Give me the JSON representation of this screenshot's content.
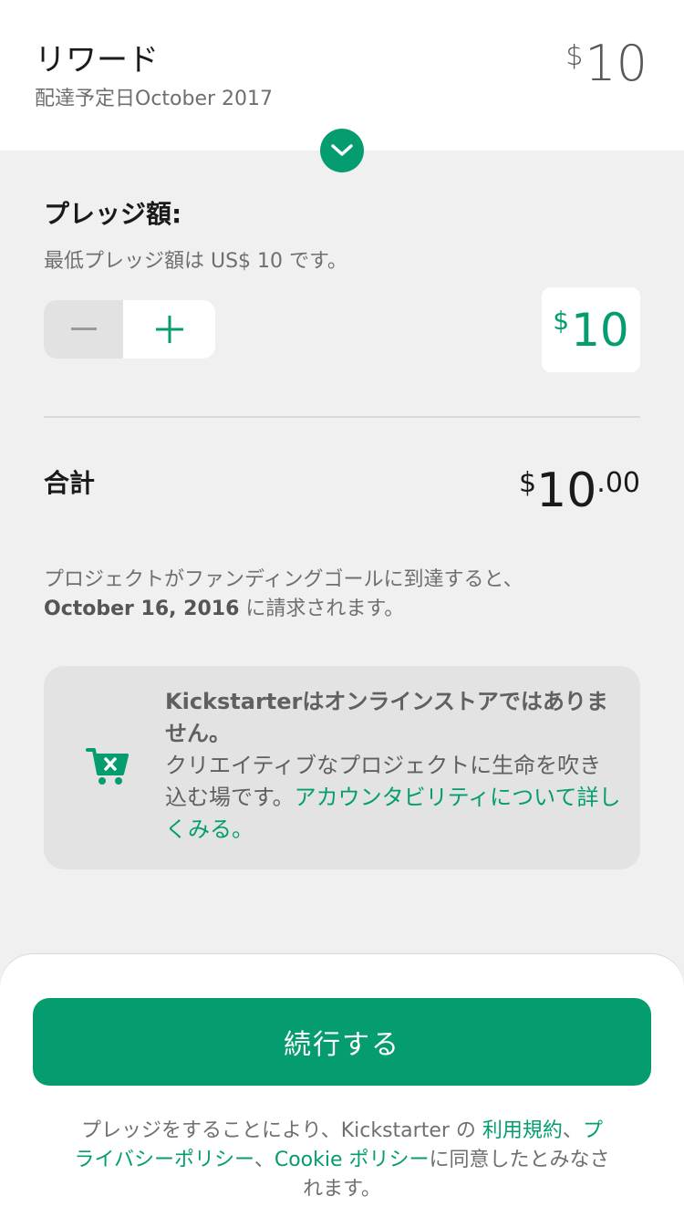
{
  "header": {
    "title": "リワード",
    "subtitle": "配達予定日October 2017",
    "price_currency": "$",
    "price_value": "10"
  },
  "pledge": {
    "label": "プレッジ額:",
    "minimum_note": "最低プレッジ額は US$ 10 です。",
    "amount_currency": "$",
    "amount_value": "10"
  },
  "total": {
    "label": "合計",
    "currency": "$",
    "whole": "10",
    "cents": ".00"
  },
  "charge_note": {
    "line1": "プロジェクトがファンディングゴールに到達すると、",
    "date": "October 16, 2016",
    "line2_suffix": " に請求されます。"
  },
  "info_card": {
    "bold_text": "Kickstarterはオンラインストアではありません。",
    "body_text": "クリエイティブなプロジェクトに生命を吹き込む場です。",
    "link_text": "アカウンタビリティについて詳しくみる。"
  },
  "footer": {
    "continue_label": "続行する",
    "legal_prefix": "プレッジをすることにより、Kickstarter の ",
    "terms_link": "利用規約",
    "separator1": "、",
    "privacy_link": "プライバシーポリシー",
    "separator2": "、",
    "cookie_link": "Cookie ポリシー",
    "legal_suffix": "に同意したとみなされます。"
  },
  "colors": {
    "accent": "#059d6f",
    "background": "#f0f0f0"
  }
}
